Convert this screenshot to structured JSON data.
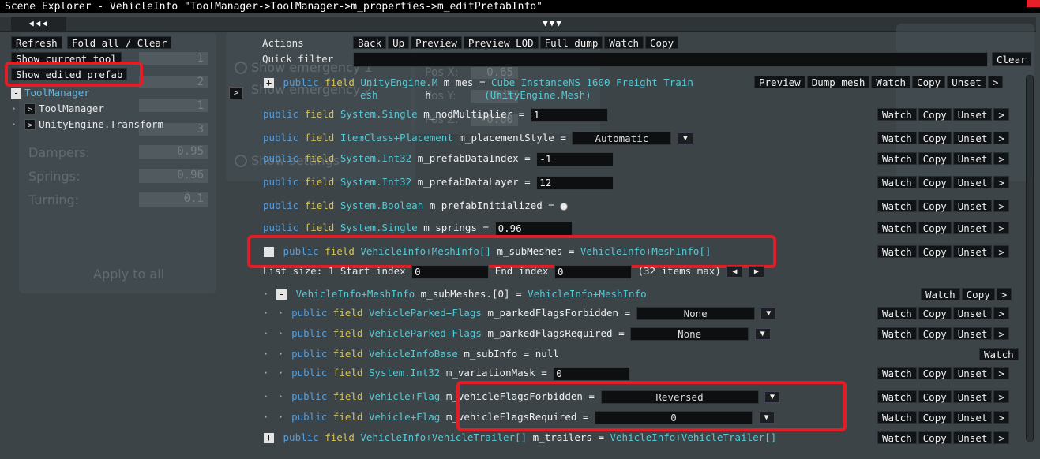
{
  "window": {
    "title": "Scene Explorer - VehicleInfo \"ToolManager->ToolManager->m_properties->m_editPrefabInfo\"",
    "collapse_left": "◀◀◀",
    "collapse_center": "▼▼▼"
  },
  "background_ui": {
    "left_items": [
      "Show emergency 1",
      "Show emergency 2",
      "Show settings"
    ],
    "ghost_left_labels": [
      "Dampers:",
      "Springs:",
      "Turning:"
    ],
    "ghost_left_values": [
      "0.95",
      "0.96",
      "0.1"
    ],
    "ghost_small_values": [
      "1",
      "2",
      "1",
      "3"
    ],
    "apply_all": "Apply to all",
    "pos_labels": [
      "Pos X:",
      "Pos Y:",
      "Pos Z:"
    ],
    "pos_values": [
      "0.65",
      "0.5",
      "-0.60"
    ]
  },
  "left_panel": {
    "buttons": {
      "refresh": "Refresh",
      "fold_all": "Fold all / Clear",
      "show_current_tool": "Show current tool",
      "show_edited_prefab": "Show edited prefab"
    },
    "tree": [
      {
        "label": "ToolManager",
        "toggle": "-"
      },
      {
        "label": "ToolManager",
        "toggle": ">"
      },
      {
        "label": "UnityEngine.Transform",
        "toggle": ">"
      }
    ]
  },
  "actions_bar": {
    "label": "Actions",
    "buttons": [
      "Back",
      "Up",
      "Preview",
      "Preview LOD",
      "Full dump",
      "Watch",
      "Copy"
    ],
    "quick_filter_label": "Quick filter",
    "quick_filter_value": "",
    "clear": "Clear"
  },
  "row_actions": {
    "watch": "Watch",
    "copy": "Copy",
    "unset": "Unset",
    "more": ">",
    "preview": "Preview",
    "dump_mesh": "Dump mesh"
  },
  "fields": {
    "mesh": {
      "toggle": "+",
      "kw": "public",
      "fld": "field",
      "type_l1": "UnityEngine.M",
      "type_l2": "esh",
      "name_l1": "m_mes",
      "name_l2": "h",
      "eq": "=",
      "val_l1": "Cube InstanceNS 1600 Freight Train",
      "val_l2": "(UnityEngine.Mesh)"
    },
    "nodMultiplier": {
      "kw": "public",
      "fld": "field",
      "type": "System.Single",
      "name": "m_nodMultiplier",
      "eq": "=",
      "value": "1"
    },
    "placementStyle": {
      "kw": "public",
      "fld": "field",
      "type": "ItemClass+Placement",
      "name": "m_placementStyle",
      "eq": "=",
      "value": "Automatic"
    },
    "prefabDataIndex": {
      "kw": "public",
      "fld": "field",
      "type": "System.Int32",
      "name": "m_prefabDataIndex",
      "eq": "=",
      "value": "-1"
    },
    "prefabDataLayer": {
      "kw": "public",
      "fld": "field",
      "type": "System.Int32",
      "name": "m_prefabDataLayer",
      "eq": "=",
      "value": "12"
    },
    "prefabInitialized": {
      "kw": "public",
      "fld": "field",
      "type": "System.Boolean",
      "name": "m_prefabInitialized",
      "eq": "="
    },
    "springs": {
      "kw": "public",
      "fld": "field",
      "type": "System.Single",
      "name": "m_springs",
      "eq": "=",
      "value": "0.96"
    },
    "subMeshes": {
      "toggle": "-",
      "kw": "public",
      "fld": "field",
      "type": "VehicleInfo+MeshInfo[]",
      "name": "m_subMeshes",
      "eq": "=",
      "val": "VehicleInfo+MeshInfo[]"
    },
    "list_info": {
      "size_text": "List size: 1 Start index",
      "start": "0",
      "end_label": "End index",
      "end": "0",
      "max_text": "(32 items max)",
      "prev": "◀",
      "next": "▶"
    },
    "subMeshes0": {
      "dots": "·",
      "toggle": "-",
      "type": "VehicleInfo+MeshInfo",
      "name": "m_subMeshes.[0]",
      "eq": "=",
      "val": "VehicleInfo+MeshInfo"
    },
    "parkedForbidden": {
      "dots": "· ·",
      "kw": "public",
      "fld": "field",
      "type": "VehicleParked+Flags",
      "name": "m_parkedFlagsForbidden",
      "eq": "=",
      "value": "None"
    },
    "parkedRequired": {
      "dots": "· ·",
      "kw": "public",
      "fld": "field",
      "type": "VehicleParked+Flags",
      "name": "m_parkedFlagsRequired",
      "eq": "=",
      "value": "None"
    },
    "subInfo": {
      "dots": "· ·",
      "kw": "public",
      "fld": "field",
      "type": "VehicleInfoBase",
      "name": "m_subInfo",
      "eq": "=",
      "val": "null"
    },
    "variationMask": {
      "dots": "· ·",
      "kw": "public",
      "fld": "field",
      "type": "System.Int32",
      "name": "m_variationMask",
      "eq": "=",
      "value": "0"
    },
    "flagsForbidden": {
      "dots": "· ·",
      "kw": "public",
      "fld": "field",
      "type": "Vehicle+Flag",
      "name": "m_vehicleFlagsForbidden",
      "eq": "=",
      "value": "Reversed"
    },
    "flagsRequired": {
      "dots": "· ·",
      "kw": "public",
      "fld": "field",
      "type": "Vehicle+Flag",
      "name": "m_vehicleFlagsRequired",
      "eq": "=",
      "value": "0"
    },
    "trailers": {
      "toggle": "+",
      "kw": "public",
      "fld": "field",
      "type": "VehicleInfo+VehicleTrailer[]",
      "name": "m_trailers",
      "eq": "=",
      "val": "VehicleInfo+VehicleTrailer[]"
    }
  },
  "dropdown_arrow": "▼",
  "expand_arrow": ">",
  "highlight_color": "#e21d26"
}
